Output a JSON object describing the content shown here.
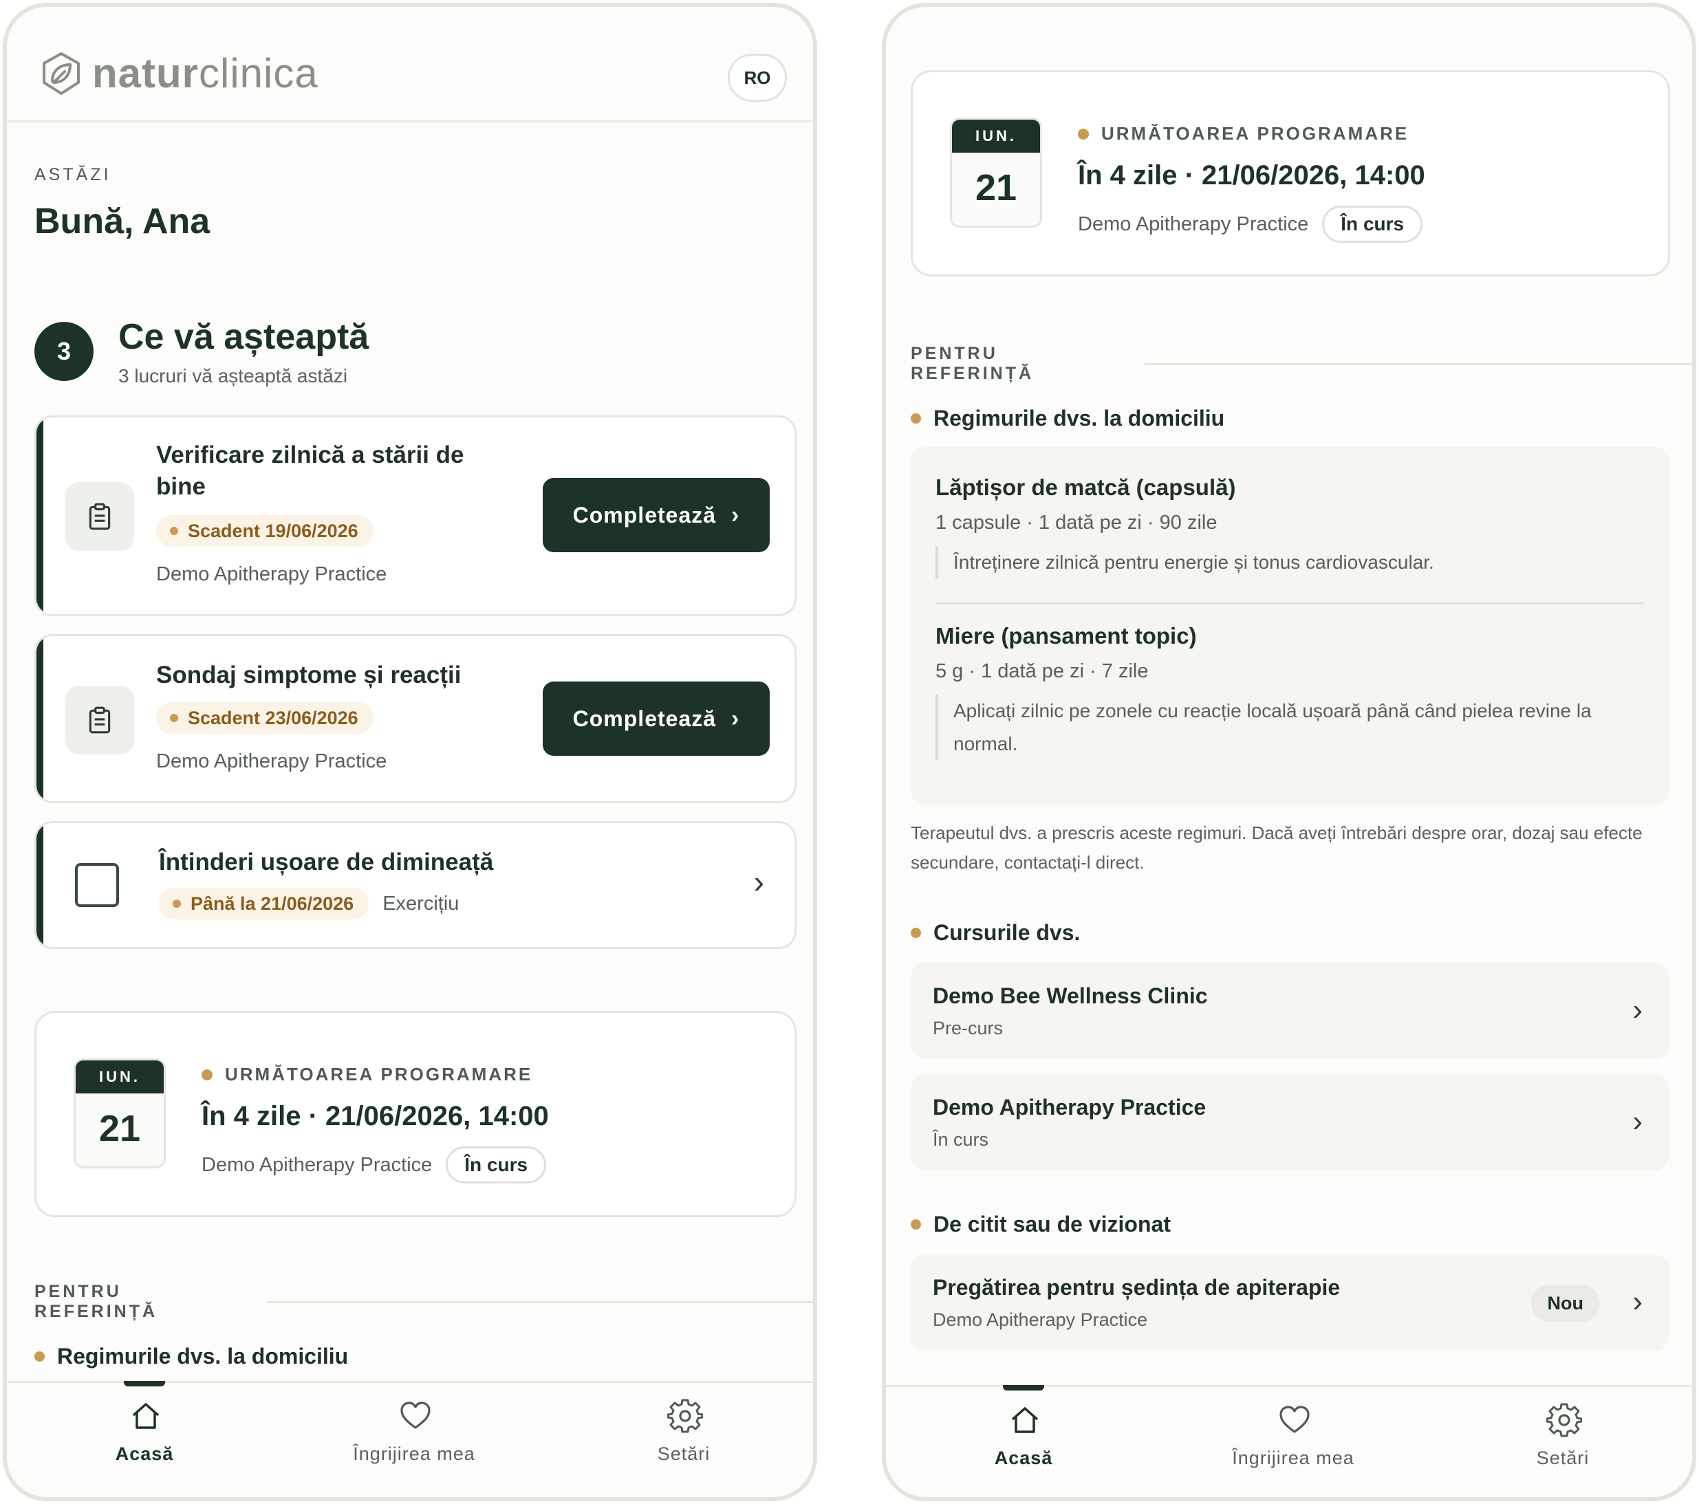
{
  "left": {
    "brand": {
      "name_bold": "natur",
      "name_light": "clinica"
    },
    "lang": "RO",
    "eyebrow": "ASTĂZI",
    "greeting": "Bună, Ana",
    "pending": {
      "count": "3",
      "title": "Ce vă așteaptă",
      "subtitle": "3 lucruri vă așteaptă astăzi"
    },
    "tasks": [
      {
        "title_line1": "Verificare zilnică a stării de",
        "title_line2": "bine",
        "due": "Scadent 19/06/2026",
        "org": "Demo Apitherapy Practice",
        "action": "Completează",
        "icon": "clipboard-icon"
      },
      {
        "title": "Sondaj simptome și reacții",
        "due": "Scadent 23/06/2026",
        "org": "Demo Apitherapy Practice",
        "action": "Completează",
        "icon": "clipboard-icon"
      },
      {
        "title": "Întinderi ușoare de dimineață",
        "due": "Până la 21/06/2026",
        "kind": "Exercițiu"
      }
    ],
    "appointment": {
      "month": "IUN.",
      "day": "21",
      "eyebrow": "URMĂTOAREA PROGRAMARE",
      "when": "În 4 zile · 21/06/2026, 14:00",
      "org": "Demo Apitherapy Practice",
      "status": "În curs"
    },
    "reference": {
      "heading": "PENTRU REFERINȚĂ",
      "regimens_heading": "Regimurile dvs. la domiciliu"
    }
  },
  "right": {
    "appointment": {
      "month": "IUN.",
      "day": "21",
      "eyebrow": "URMĂTOAREA PROGRAMARE",
      "when": "În 4 zile · 21/06/2026, 14:00",
      "org": "Demo Apitherapy Practice",
      "status": "În curs"
    },
    "reference": {
      "heading": "PENTRU REFERINȚĂ",
      "regimens_heading": "Regimurile dvs. la domiciliu",
      "regimens": [
        {
          "name": "Lăptișor de matcă (capsulă)",
          "dose": "1 capsule · 1 dată pe zi · 90 zile",
          "note": "Întreținere zilnică pentru energie și tonus cardiovascular."
        },
        {
          "name": "Miere (pansament topic)",
          "dose": "5 g · 1 dată pe zi · 7 zile",
          "note": "Aplicați zilnic pe zonele cu reacție locală ușoară până când pielea revine la normal."
        }
      ],
      "disclaimer": "Terapeutul dvs. a prescris aceste regimuri. Dacă aveți întrebări despre orar, dozaj sau efecte secundare, contactați-l direct.",
      "courses_heading": "Cursurile dvs.",
      "courses": [
        {
          "name": "Demo Bee Wellness Clinic",
          "status": "Pre-curs"
        },
        {
          "name": "Demo Apitherapy Practice",
          "status": "În curs"
        }
      ],
      "reading_heading": "De citit sau de vizionat",
      "reading": [
        {
          "title": "Pregătirea pentru ședința de apiterapie",
          "org": "Demo Apitherapy Practice",
          "badge": "Nou"
        }
      ]
    }
  },
  "tabs": [
    {
      "label": "Acasă",
      "icon": "home-icon",
      "active": true
    },
    {
      "label": "Îngrijirea mea",
      "icon": "heart-icon",
      "active": false
    },
    {
      "label": "Setări",
      "icon": "gear-icon",
      "active": false
    }
  ],
  "colors": {
    "primary": "#1d3327",
    "accent": "#c99a52",
    "due_bg": "#fbf3e6",
    "due_text": "#8a5d1f"
  }
}
